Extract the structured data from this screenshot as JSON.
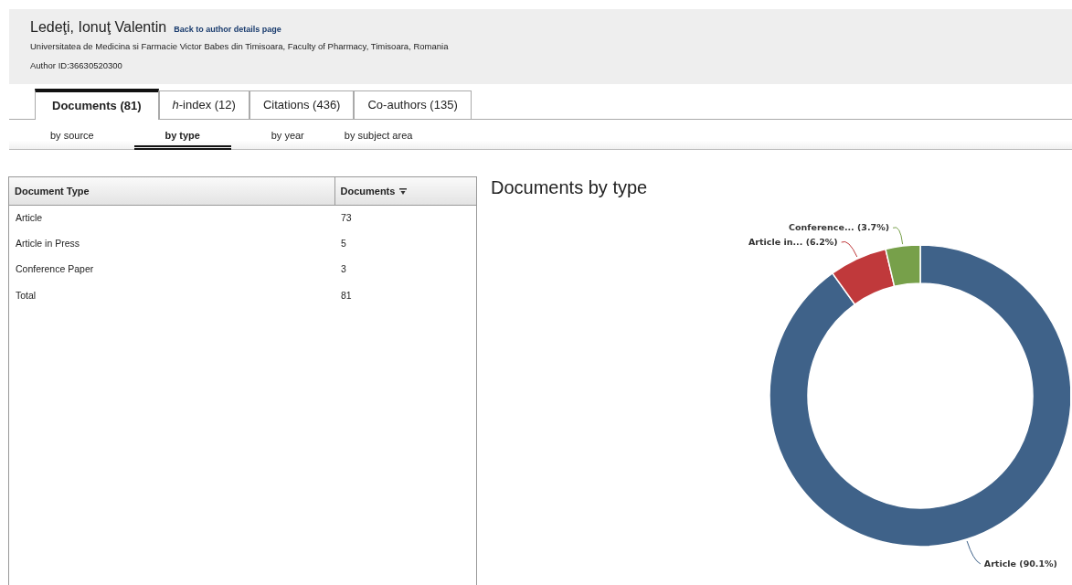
{
  "author": {
    "name": "Ledeţi, Ionuţ Valentin",
    "back_link": "Back to author details page",
    "affiliation": "Universitatea de Medicina si Farmacie Victor Babes din Timisoara, Faculty of Pharmacy, Timisoara, Romania",
    "author_id": "Author ID:36630520300"
  },
  "tabs": [
    {
      "label": "Documents (81)",
      "selected": true
    },
    {
      "label": "*h*-index (12)",
      "selected": false
    },
    {
      "label": "Citations (436)",
      "selected": false
    },
    {
      "label": "Co-authors (135)",
      "selected": false
    }
  ],
  "subtabs": [
    {
      "label": "by source",
      "selected": false
    },
    {
      "label": "by type",
      "selected": true
    },
    {
      "label": "by year",
      "selected": false
    },
    {
      "label": "by subject area",
      "selected": false
    }
  ],
  "table": {
    "columns": [
      "Document Type",
      "Documents"
    ],
    "rows": [
      [
        "Article",
        "73"
      ],
      [
        "Article in Press",
        "5"
      ],
      [
        "Conference Paper",
        "3"
      ],
      [
        "Total",
        "81"
      ]
    ]
  },
  "chart": {
    "chart_data": {
      "type": "donut",
      "title": "Documents by type",
      "categories": [
        "Article",
        "Article in...",
        "Conference..."
      ],
      "values": [
        90.1,
        6.2,
        3.7
      ],
      "value_labels": [
        "(90.1%)",
        "(6.2%)",
        "(3.7%)"
      ]
    }
  }
}
